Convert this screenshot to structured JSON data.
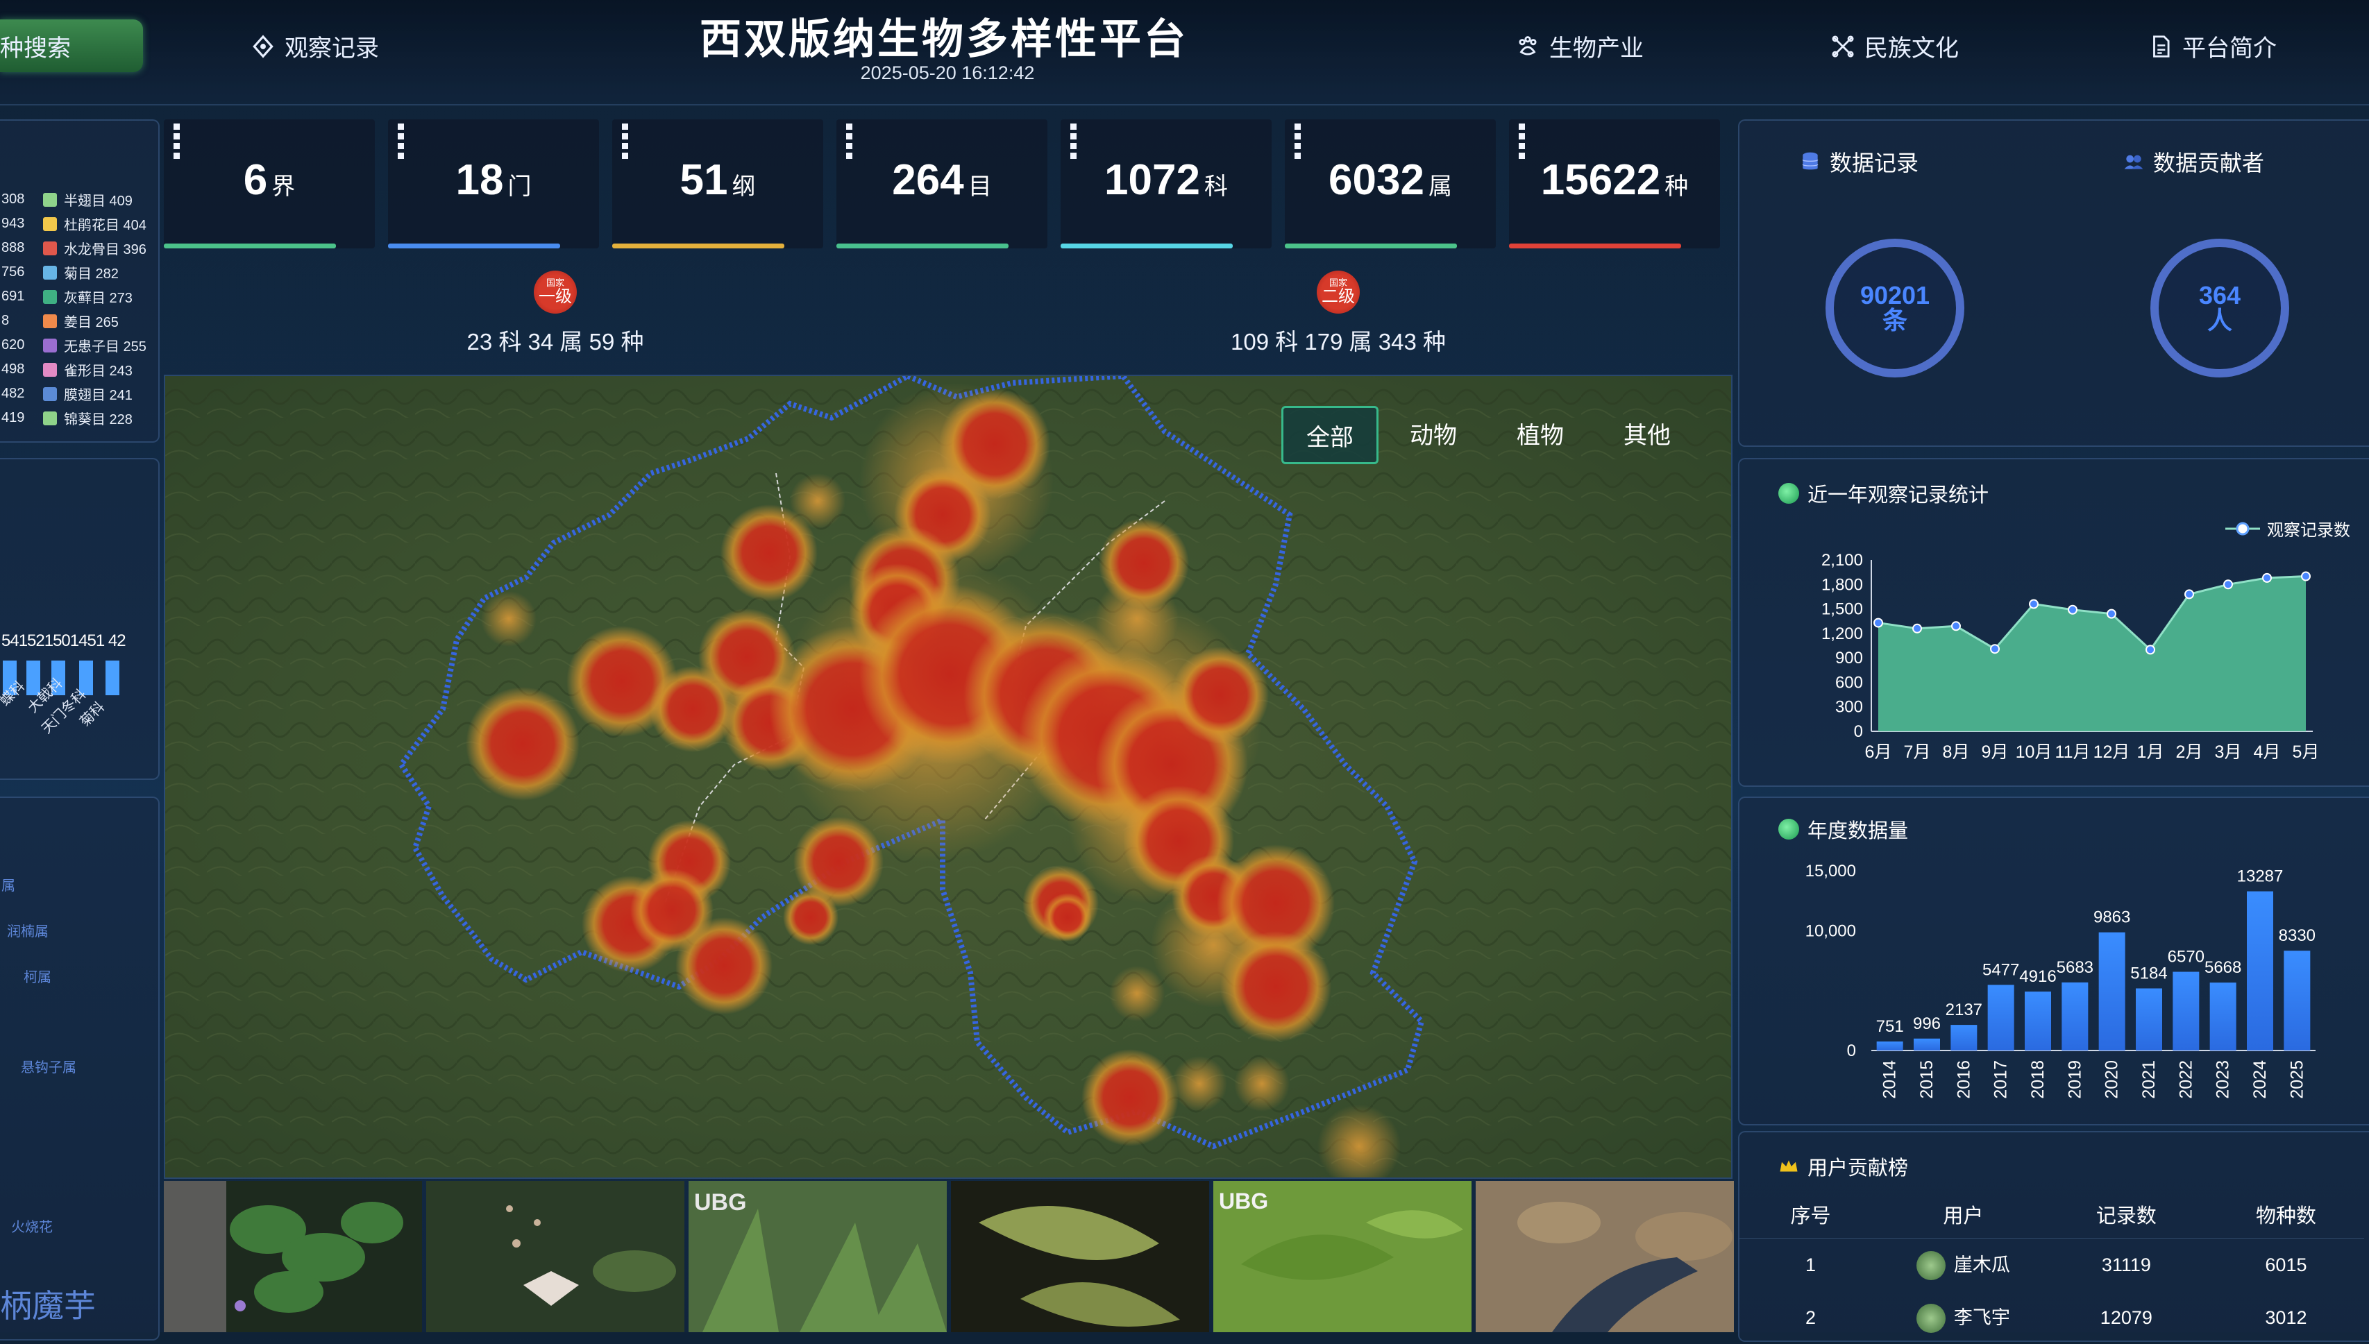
{
  "header": {
    "title": "西双版纳生物多样性平台",
    "datetime": "2025-05-20 16:12:42",
    "nav_active": "种搜索",
    "nav": [
      {
        "label": "观察记录"
      },
      {
        "label": "生物产业"
      },
      {
        "label": "民族文化"
      },
      {
        "label": "平台简介"
      }
    ]
  },
  "stats": [
    {
      "value": "6",
      "unit": "界",
      "color": "#4cc38a"
    },
    {
      "value": "18",
      "unit": "门",
      "color": "#4a8df0"
    },
    {
      "value": "51",
      "unit": "纲",
      "color": "#e5b13c"
    },
    {
      "value": "264",
      "unit": "目",
      "color": "#49c18e"
    },
    {
      "value": "1072",
      "unit": "科",
      "color": "#57d6e6"
    },
    {
      "value": "6032",
      "unit": "属",
      "color": "#4cc38a"
    },
    {
      "value": "15622",
      "unit": "种",
      "color": "#e04238"
    }
  ],
  "protection": [
    {
      "seal_top": "国家",
      "seal_main": "一级",
      "text": "23 科 34 属 59 种"
    },
    {
      "seal_top": "国家",
      "seal_main": "二级",
      "text": "109 科 179 属 343 种"
    }
  ],
  "map_filters": [
    "全部",
    "动物",
    "植物",
    "其他"
  ],
  "left_legend": {
    "col1": [
      "308",
      "943",
      "888",
      "756",
      "691",
      "8",
      "620",
      "498",
      "482",
      "419"
    ],
    "col2": [
      {
        "label": "半翅目 409",
        "color": "#8fd38a"
      },
      {
        "label": "杜鹃花目 404",
        "color": "#f2c84b"
      },
      {
        "label": "水龙骨目 396",
        "color": "#e0584c"
      },
      {
        "label": "菊目 282",
        "color": "#67b5e6"
      },
      {
        "label": "灰藓目 273",
        "color": "#3fb083"
      },
      {
        "label": "姜目 265",
        "color": "#f08a4b"
      },
      {
        "label": "无患子目 255",
        "color": "#9a6ed0"
      },
      {
        "label": "雀形目 243",
        "color": "#e28ac4"
      },
      {
        "label": "膜翅目 241",
        "color": "#5b8bd6"
      },
      {
        "label": "锦葵目 228",
        "color": "#8fd38a"
      }
    ]
  },
  "left_bars": {
    "values_text": "541521501451 42",
    "labels": [
      "蝶科",
      "大戟科",
      "天门冬科",
      "菊科"
    ]
  },
  "left_list": [
    "属",
    "润楠属",
    "柯属",
    "悬钩子属",
    "火烧花"
  ],
  "left_bottom_text": "柄魔芋",
  "right": {
    "records_label": "数据记录",
    "contrib_label": "数据贡献者",
    "records_value": "90201",
    "records_unit": "条",
    "contrib_value": "364",
    "contrib_unit": "人"
  },
  "chart_data": [
    {
      "type": "area",
      "title": "近一年观察记录统计",
      "legend": "观察记录数",
      "categories": [
        "6月",
        "7月",
        "8月",
        "9月",
        "10月",
        "11月",
        "12月",
        "1月",
        "2月",
        "3月",
        "4月",
        "5月"
      ],
      "values": [
        1330,
        1260,
        1290,
        1010,
        1560,
        1490,
        1440,
        1000,
        1680,
        1800,
        1880,
        1900
      ],
      "ylim": [
        0,
        2100
      ],
      "yticks": [
        "2,100",
        "1,800",
        "1,500",
        "1,200",
        "900",
        "600",
        "300",
        "0"
      ]
    },
    {
      "type": "bar",
      "title": "年度数据量",
      "categories": [
        "2014",
        "2015",
        "2016",
        "2017",
        "2018",
        "2019",
        "2020",
        "2021",
        "2022",
        "2023",
        "2024",
        "2025"
      ],
      "values": [
        751,
        996,
        2137,
        5477,
        4916,
        5683,
        9863,
        5184,
        6570,
        5668,
        13287,
        8330
      ],
      "ylim": [
        0,
        15000
      ],
      "yticks": [
        "15,000",
        "10,000",
        "0"
      ]
    }
  ],
  "rank": {
    "title": "用户贡献榜",
    "headers": [
      "序号",
      "用户",
      "记录数",
      "物种数"
    ],
    "rows": [
      {
        "no": "1",
        "user": "崖木瓜",
        "records": "31119",
        "species": "6015"
      },
      {
        "no": "2",
        "user": "李飞宇",
        "records": "12079",
        "species": "3012"
      }
    ]
  }
}
